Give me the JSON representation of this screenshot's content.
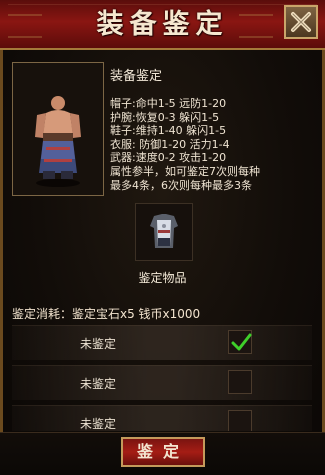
{
  "window": {
    "title": "装备鉴定"
  },
  "equipment": {
    "name": "装备鉴定",
    "stats": [
      "帽子:命中1-5 远防1-20",
      "护腕:恢复0-3 躲闪1-5",
      "鞋子:维持1-40 躲闪1-5",
      "衣服: 防御1-20 活力1-4",
      "武器:速度0-2 攻击1-20",
      "属性参半，如可鉴定7次则每种",
      "最多4条，6次则每种最多3条"
    ]
  },
  "item": {
    "label": "鉴定物品"
  },
  "cost": {
    "text": "鉴定消耗：鉴定宝石x5 钱币x1000"
  },
  "attributes": [
    {
      "label": "未鉴定",
      "checked": true
    },
    {
      "label": "未鉴定",
      "checked": false
    },
    {
      "label": "未鉴定",
      "checked": false
    }
  ],
  "buttons": {
    "identify": "鉴定"
  },
  "colors": {
    "title_bar": "#8a1612",
    "border_gold": "#c49a5b",
    "check": "#3fcf2a"
  }
}
